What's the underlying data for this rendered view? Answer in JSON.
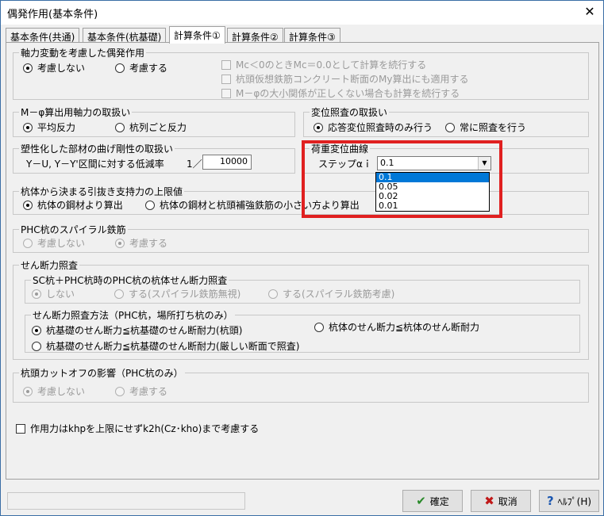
{
  "window": {
    "title": "偶発作用(基本条件)",
    "close_glyph": "✕"
  },
  "tabs": [
    {
      "label": "基本条件(共通)"
    },
    {
      "label": "基本条件(杭基礎)"
    },
    {
      "label": "計算条件①"
    },
    {
      "label": "計算条件②"
    },
    {
      "label": "計算条件③"
    }
  ],
  "axial": {
    "title": "軸力変動を考慮した偶発作用",
    "opt_no": "考慮しない",
    "opt_yes": "考慮する",
    "chk1": "Mc＜0のときMc＝0.0として計算を続行する",
    "chk2": "杭頭仮想鉄筋コンクリート断面のMy算出にも適用する",
    "chk3": "M－φの大小関係が正しくない場合も計算を続行する"
  },
  "m_phi": {
    "title": "M－φ算出用軸力の取扱い",
    "opt1": "平均反力",
    "opt2": "杭列ごと反力"
  },
  "disp_check": {
    "title": "変位照査の取扱い",
    "opt1": "応答変位照査時のみ行う",
    "opt2": "常に照査を行う"
  },
  "plastic": {
    "title": "塑性化した部材の曲げ剛性の取扱い",
    "label": "Y－U, Y－Y'区間に対する低減率",
    "prefix": "1／",
    "value": "10000"
  },
  "load_curve": {
    "title": "荷重変位曲線",
    "step_label": "ステップαｉ",
    "selected": "0.1",
    "options": [
      "0.1",
      "0.05",
      "0.02",
      "0.01"
    ]
  },
  "pullout": {
    "title": "杭体から決まる引抜き支持力の上限値",
    "opt1": "杭体の鋼材より算出",
    "opt2": "杭体の鋼材と杭頭補強鉄筋の小さい方より算出"
  },
  "phc_spiral": {
    "title": "PHC杭のスパイラル鉄筋",
    "opt1": "考慮しない",
    "opt2": "考慮する"
  },
  "shear": {
    "title": "せん断力照査",
    "sc": {
      "title": "SC杭＋PHC杭時のPHC杭の杭体せん断力照査",
      "opt1": "しない",
      "opt2": "する(スパイラル鉄筋無視)",
      "opt3": "する(スパイラル鉄筋考慮)"
    },
    "method": {
      "title": "せん断力照査方法（PHC杭，場所打ち杭のみ）",
      "opt1": "杭基礎のせん断力≦杭基礎のせん断耐力(杭頭)",
      "opt2": "杭基礎のせん断力≦杭基礎のせん断耐力(厳しい断面で照査)",
      "opt3": "杭体のせん断力≦杭体のせん断耐力"
    }
  },
  "cutoff": {
    "title": "杭頭カットオフの影響（PHC杭のみ）",
    "opt1": "考慮しない",
    "opt2": "考慮する"
  },
  "khp_check": "作用力はkhpを上限にせずk2h(Cz･kho)まで考慮する",
  "buttons": {
    "ok": "確定",
    "cancel": "取消",
    "help": "ﾍﾙﾌﾟ(H)"
  },
  "icons": {
    "ok": "✔",
    "cancel": "✖",
    "help": "?"
  },
  "colors": {
    "highlight": "#e02020",
    "selection": "#0078d7",
    "ok_icon": "#2a8a2a",
    "cancel_icon": "#c01818",
    "help_icon": "#1a56b0"
  }
}
